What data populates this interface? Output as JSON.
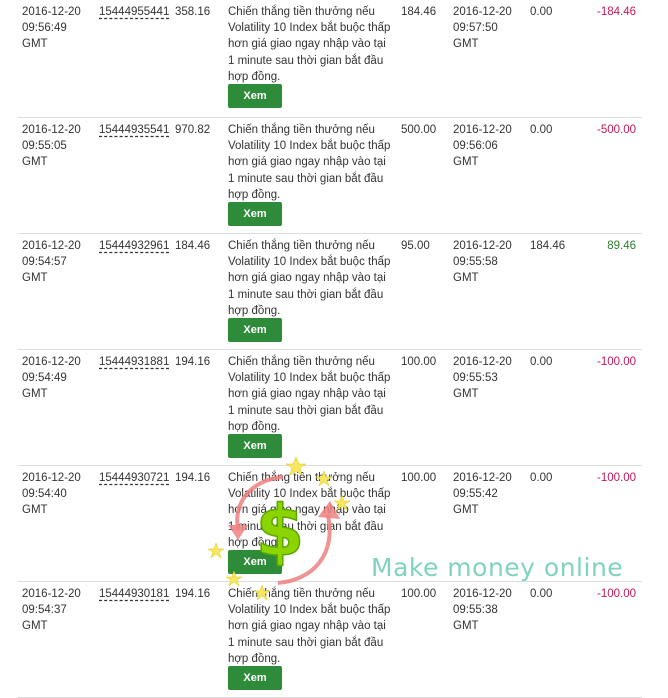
{
  "rows": [
    {
      "purchase_time": "2016-12-20 09:56:49 GMT",
      "ref": "15444955441",
      "buy_price": "358.16",
      "description": "Chiến thắng tiền thưởng nếu Volatility 10 Index bắt buộc thấp hơn giá giao ngay nhập vào tại 1 minute sau thời gian bắt đầu hợp đồng.",
      "stake": "184.46",
      "sell_time": "2016-12-20 09:57:50 GMT",
      "sell_price": "0.00",
      "profit_loss": "-184.46",
      "button": "Xem"
    },
    {
      "purchase_time": "2016-12-20 09:55:05 GMT",
      "ref": "15444935541",
      "buy_price": "970.82",
      "description": "Chiến thắng tiền thưởng nếu Volatility 10 Index bắt buộc thấp hơn giá giao ngay nhập vào tại 1 minute sau thời gian bắt đầu hợp đồng.",
      "stake": "500.00",
      "sell_time": "2016-12-20 09:56:06 GMT",
      "sell_price": "0.00",
      "profit_loss": "-500.00",
      "button": "Xem"
    },
    {
      "purchase_time": "2016-12-20 09:54:57 GMT",
      "ref": "15444932961",
      "buy_price": "184.46",
      "description": "Chiến thắng tiền thưởng nếu Volatility 10 Index bắt buộc thấp hơn giá giao ngay nhập vào tại 1 minute sau thời gian bắt đầu hợp đồng.",
      "stake": "95.00",
      "sell_time": "2016-12-20 09:55:58 GMT",
      "sell_price": "184.46",
      "profit_loss": "89.46",
      "button": "Xem"
    },
    {
      "purchase_time": "2016-12-20 09:54:49 GMT",
      "ref": "15444931881",
      "buy_price": "194.16",
      "description": "Chiến thắng tiền thưởng nếu Volatility 10 Index bắt buộc thấp hơn giá giao ngay nhập vào tại 1 minute sau thời gian bắt đầu hợp đồng.",
      "stake": "100.00",
      "sell_time": "2016-12-20 09:55:53 GMT",
      "sell_price": "0.00",
      "profit_loss": "-100.00",
      "button": "Xem"
    },
    {
      "purchase_time": "2016-12-20 09:54:40 GMT",
      "ref": "15444930721",
      "buy_price": "194.16",
      "description": "Chiến thắng tiền thưởng nếu Volatility 10 Index bắt buộc thấp hơn giá giao ngay nhập vào tại 1 minute sau thời gian bắt đầu hợp đồng.",
      "stake": "100.00",
      "sell_time": "2016-12-20 09:55:42 GMT",
      "sell_price": "0.00",
      "profit_loss": "-100.00",
      "button": "Xem"
    },
    {
      "purchase_time": "2016-12-20 09:54:37 GMT",
      "ref": "15444930181",
      "buy_price": "194.16",
      "description": "Chiến thắng tiền thưởng nếu Volatility 10 Index bắt buộc thấp hơn giá giao ngay nhập vào tại 1 minute sau thời gian bắt đầu hợp đồng.",
      "stake": "100.00",
      "sell_time": "2016-12-20 09:55:38 GMT",
      "sell_price": "0.00",
      "profit_loss": "-100.00",
      "button": "Xem"
    }
  ],
  "watermark": {
    "text": "Make money online",
    "logo_icon": "dollar-sign-icon"
  },
  "colors": {
    "loss": "#c2185b",
    "profit": "#2e7d32",
    "button": "#2e8b3a",
    "watermark": "#7fd3c0"
  }
}
